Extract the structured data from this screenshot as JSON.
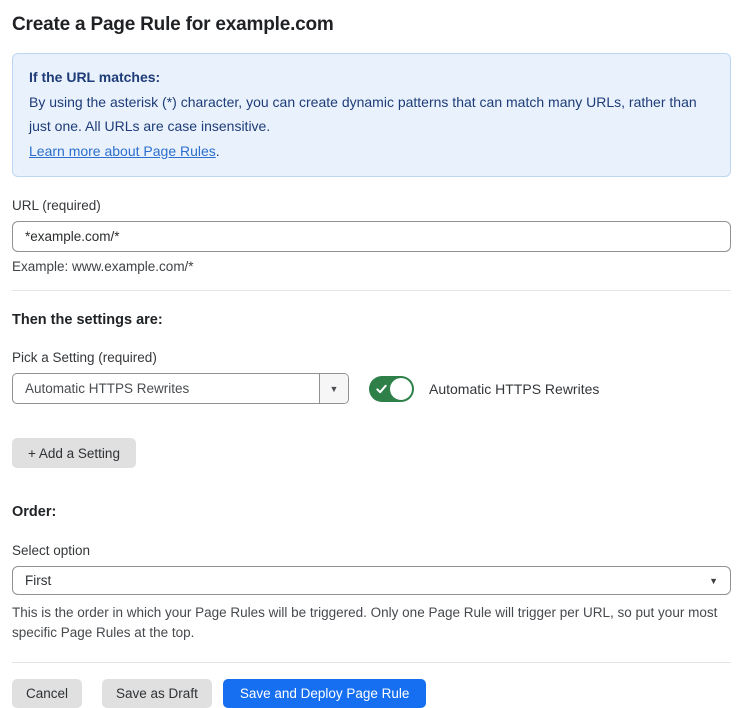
{
  "header": {
    "title": "Create a Page Rule for example.com"
  },
  "info_box": {
    "heading": "If the URL matches:",
    "body": "By using the asterisk (*) character, you can create dynamic patterns that can match many URLs, rather than just one. All URLs are case insensitive.",
    "link_label": "Learn more about Page Rules",
    "link_suffix": "."
  },
  "url_field": {
    "label": "URL (required)",
    "value": "*example.com/*",
    "hint": "Example: www.example.com/*"
  },
  "settings_section": {
    "heading": "Then the settings are:",
    "picker_label": "Pick a Setting (required)",
    "picker_value": "Automatic HTTPS Rewrites",
    "toggle_state": "on",
    "toggle_label": "Automatic HTTPS Rewrites",
    "add_setting_label": "+ Add a Setting"
  },
  "order_section": {
    "heading": "Order:",
    "select_label": "Select option",
    "select_value": "First",
    "hint": "This is the order in which your Page Rules will be triggered. Only one Page Rule will trigger per URL, so put your most specific Page Rules at the top."
  },
  "footer": {
    "cancel_label": "Cancel",
    "save_draft_label": "Save as Draft",
    "save_deploy_label": "Save and Deploy Page Rule"
  },
  "colors": {
    "info_bg": "#e9f2fc",
    "info_border": "#bcd7f3",
    "info_text": "#1e3c78",
    "link": "#2c6fcd",
    "primary_button": "#156ff0",
    "toggle_on": "#2e8048",
    "gray_button": "#e0e0e0"
  }
}
